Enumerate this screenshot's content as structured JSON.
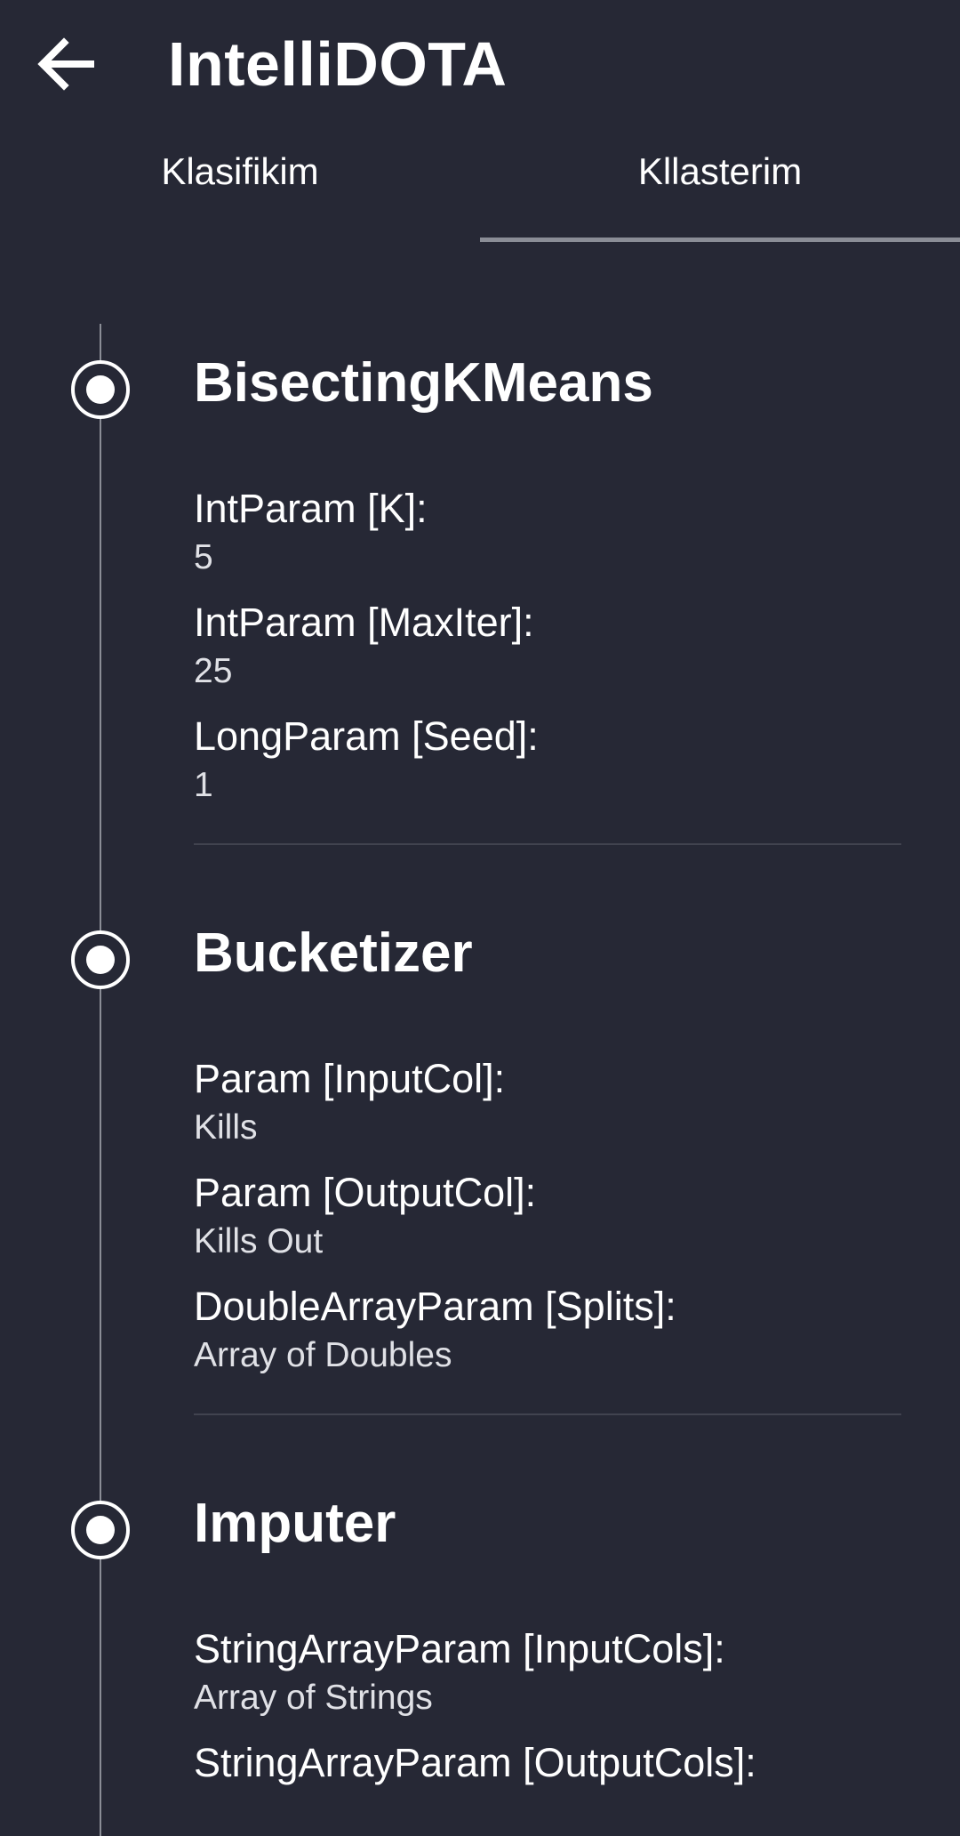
{
  "app": {
    "title": "IntelliDOTA",
    "back_icon": "arrow-left-icon"
  },
  "tabs": [
    {
      "label": "Klasifikim",
      "active": false
    },
    {
      "label": "Kllasterim",
      "active": true
    }
  ],
  "steps": [
    {
      "title": "BisectingKMeans",
      "params": [
        {
          "name": "IntParam [K]:",
          "value": "5"
        },
        {
          "name": "IntParam [MaxIter]:",
          "value": "25"
        },
        {
          "name": "LongParam [Seed]:",
          "value": "1"
        }
      ]
    },
    {
      "title": "Bucketizer",
      "params": [
        {
          "name": "Param [InputCol]:",
          "value": "Kills"
        },
        {
          "name": "Param [OutputCol]:",
          "value": "Kills Out"
        },
        {
          "name": "DoubleArrayParam [Splits]:",
          "value": "Array of Doubles"
        }
      ]
    },
    {
      "title": "Imputer",
      "params": [
        {
          "name": "StringArrayParam [InputCols]:",
          "value": "Array of Strings"
        },
        {
          "name": "StringArrayParam [OutputCols]:",
          "value": ""
        }
      ]
    }
  ],
  "colors": {
    "background": "#262835",
    "text": "#ffffff",
    "tab_indicator": "#8a8d96",
    "divider": "#41434f"
  }
}
